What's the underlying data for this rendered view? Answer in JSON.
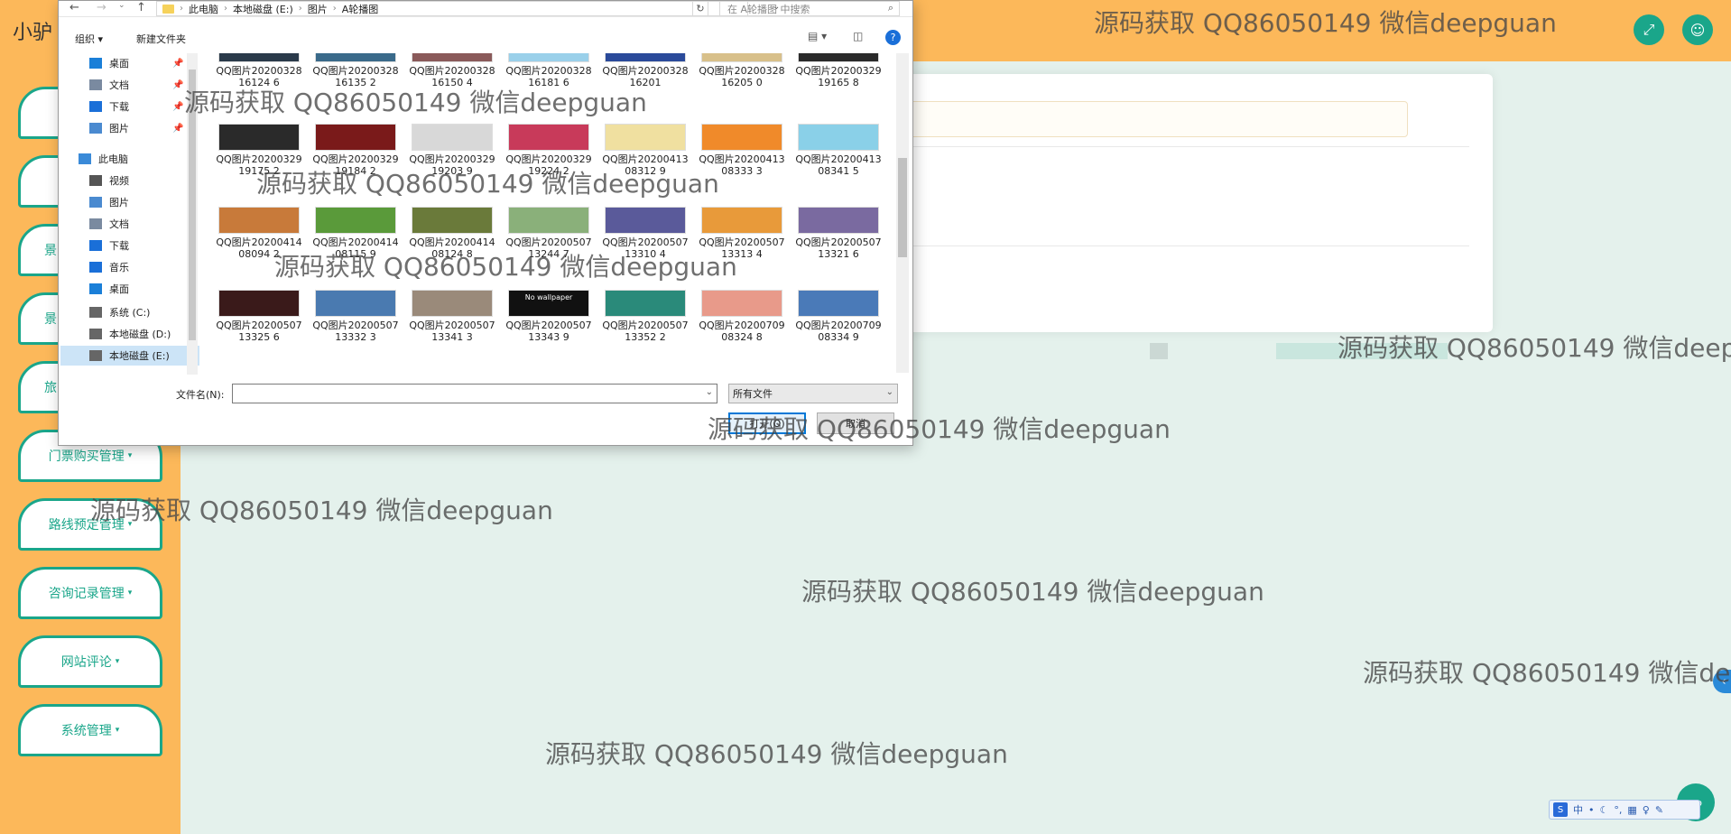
{
  "app": {
    "title": "小驴",
    "fullscreen_icon": "fullscreen-icon",
    "user_icon": "user-icon",
    "collapse_icon": "chevron-left-icon",
    "app_button_label": "pp"
  },
  "sidebar": {
    "items": [
      {
        "label": ""
      },
      {
        "label": ""
      },
      {
        "label": "景"
      },
      {
        "label": "景"
      },
      {
        "label": "旅"
      },
      {
        "label": "门票购买管理"
      },
      {
        "label": "路线预定管理"
      },
      {
        "label": "咨询记录管理"
      },
      {
        "label": "网站评论"
      },
      {
        "label": "系统管理"
      }
    ]
  },
  "dialog": {
    "breadcrumb": [
      "此电脑",
      "本地磁盘 (E:)",
      "图片",
      "A轮播图"
    ],
    "search_placeholder": "在 A轮播图 中搜索",
    "organize_label": "组织",
    "new_folder_label": "新建文件夹",
    "nav_items": [
      {
        "label": "桌面",
        "icon": "desktop-icon",
        "pinned": true
      },
      {
        "label": "文档",
        "icon": "documents-icon",
        "pinned": true
      },
      {
        "label": "下载",
        "icon": "download-icon",
        "pinned": true
      },
      {
        "label": "图片",
        "icon": "pictures-icon",
        "pinned": true
      },
      {
        "label": "此电脑",
        "icon": "computer-icon",
        "pinned": false
      },
      {
        "label": "视频",
        "icon": "video-icon",
        "pinned": false
      },
      {
        "label": "图片",
        "icon": "pictures-icon",
        "pinned": false
      },
      {
        "label": "文档",
        "icon": "documents-icon",
        "pinned": false
      },
      {
        "label": "下载",
        "icon": "download-icon",
        "pinned": false
      },
      {
        "label": "音乐",
        "icon": "music-icon",
        "pinned": false
      },
      {
        "label": "桌面",
        "icon": "desktop-icon",
        "pinned": false
      },
      {
        "label": "系统 (C:)",
        "icon": "drive-icon",
        "pinned": false
      },
      {
        "label": "本地磁盘 (D:)",
        "icon": "drive-icon",
        "pinned": false
      },
      {
        "label": "本地磁盘 (E:)",
        "icon": "drive-icon",
        "pinned": false,
        "selected": true
      }
    ],
    "files": [
      {
        "name": "QQ图片2020032816124 6",
        "color": "#2a3a4a"
      },
      {
        "name": "QQ图片2020032816135 2",
        "color": "#3a6a8a"
      },
      {
        "name": "QQ图片2020032816150 4",
        "color": "#8a5a5a"
      },
      {
        "name": "QQ图片2020032816181 6",
        "color": "#9ad0ea"
      },
      {
        "name": "QQ图片2020032816201",
        "color": "#2a4a9a"
      },
      {
        "name": "QQ图片2020032816205 0",
        "color": "#d8c08a"
      },
      {
        "name": "QQ图片2020032919165 8",
        "color": "#2a2a2a"
      },
      {
        "name": "QQ图片2020032919175 2",
        "color": "#2a2a2a"
      },
      {
        "name": "QQ图片2020032919184 2",
        "color": "#7a1a1a"
      },
      {
        "name": "QQ图片2020032919203 9",
        "color": "#d8d8d8"
      },
      {
        "name": "QQ图片2020032919224 2",
        "color": "#c83a5a"
      },
      {
        "name": "QQ图片2020041308312 9",
        "color": "#f0e0a0"
      },
      {
        "name": "QQ图片2020041308333 3",
        "color": "#f08a2a"
      },
      {
        "name": "QQ图片2020041308341 5",
        "color": "#8ad0e8"
      },
      {
        "name": "QQ图片2020041408094 2",
        "color": "#c87a3a"
      },
      {
        "name": "QQ图片2020041408115 9",
        "color": "#5a9a3a"
      },
      {
        "name": "QQ图片2020041408124 8",
        "color": "#6a7a3a"
      },
      {
        "name": "QQ图片2020050713244 7",
        "color": "#8ab07a"
      },
      {
        "name": "QQ图片2020050713310 4",
        "color": "#5a5a9a"
      },
      {
        "name": "QQ图片2020050713313 4",
        "color": "#e89a3a"
      },
      {
        "name": "QQ图片2020050713321 6",
        "color": "#7a6aa0"
      },
      {
        "name": "QQ图片2020050713325 6",
        "color": "#3a1a1a"
      },
      {
        "name": "QQ图片2020050713332 3",
        "color": "#4a7ab0"
      },
      {
        "name": "QQ图片2020050713341 3",
        "color": "#9a8a7a"
      },
      {
        "name": "QQ图片2020050713343 9",
        "color": "#111111"
      },
      {
        "name": "QQ图片2020050713352 2",
        "color": "#2a8a7a"
      },
      {
        "name": "QQ图片2020070908324 8",
        "color": "#e89a8a"
      },
      {
        "name": "QQ图片2020070908334 9",
        "color": "#4a7ab8"
      }
    ],
    "no_wallpaper_text": "No wallpaper",
    "filename_label": "文件名(N):",
    "filename_value": "",
    "filetype_value": "所有文件",
    "open_label": "打开(O)",
    "cancel_label": "取消"
  },
  "watermark": "源码获取 QQ86050149 微信deepguan",
  "ime": {
    "labels": [
      "中",
      "•",
      "☾",
      "°,",
      "▦",
      "♀",
      "✎"
    ]
  }
}
